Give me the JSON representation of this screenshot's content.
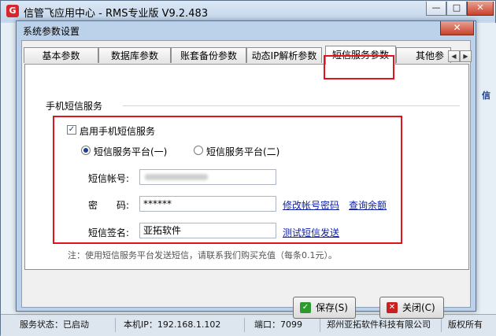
{
  "app": {
    "title": "信管飞应用中心 - RMS专业版 V9.2.483",
    "logo_glyph": "G",
    "window_controls": {
      "minimize": "—",
      "maximize": "□",
      "close": "✕"
    },
    "side_text": "信"
  },
  "dialog": {
    "title": "系统参数设置",
    "close_glyph": "✕",
    "tabs": [
      {
        "label": "基本参数",
        "active": false
      },
      {
        "label": "数据库参数",
        "active": false
      },
      {
        "label": "账套备份参数",
        "active": false
      },
      {
        "label": "动态IP解析参数",
        "active": false
      },
      {
        "label": "短信服务参数",
        "active": true
      },
      {
        "label": "其他参数",
        "active": false
      }
    ],
    "tab_scroll": {
      "left": "◀",
      "right": "▶"
    }
  },
  "sms": {
    "group_label": "手机短信服务",
    "enable_label": "启用手机短信服务",
    "enable_checked": true,
    "check_glyph": "✓",
    "platform_1": "短信服务平台(一)",
    "platform_2": "短信服务平台(二)",
    "selected_platform": 1,
    "account_label": "短信帐号:",
    "account_value": "",
    "password_label": "密　　码:",
    "password_value": "******",
    "change_password_link": "修改帐号密码",
    "query_balance_link": "查询余额",
    "signature_label": "短信签名:",
    "signature_value": "亚拓软件",
    "test_send_link": "测试短信发送",
    "note": "注：使用短信服务平台发送短信，请联系我们购买充值（每条0.1元）。"
  },
  "buttons": {
    "save_label": "保存(S)",
    "close_label": "关闭(C)",
    "save_icon_glyph": "✓",
    "close_icon_glyph": "✕",
    "save_icon_color": "#2e9a2e",
    "close_icon_color": "#c8201e"
  },
  "status_bar": {
    "service_status": "服务状态：已启动",
    "local_ip": "本机IP：192.168.1.102",
    "port": "端口：7099",
    "company": "郑州亚拓软件科技有限公司",
    "copyright": "版权所有"
  },
  "colors": {
    "highlight_red": "#e0141c",
    "link_blue": "#0a1ea8"
  }
}
